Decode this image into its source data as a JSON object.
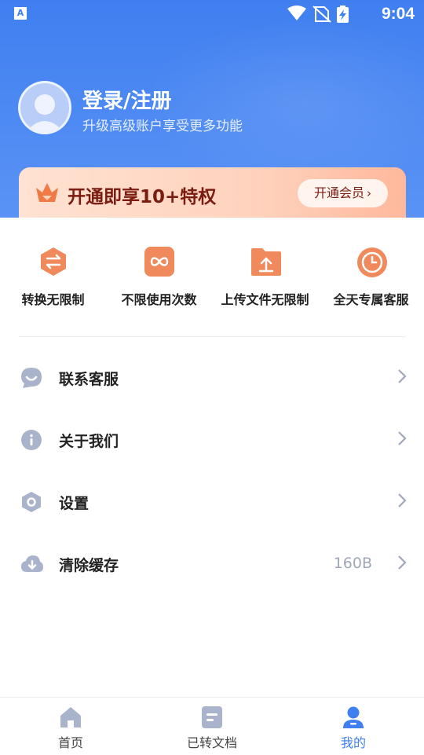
{
  "status_bar": {
    "time": "9:04",
    "left_icon_text": "A",
    "icons": [
      "wifi-icon",
      "sim-off-icon",
      "battery-charging-icon"
    ]
  },
  "profile": {
    "title": "登录/注册",
    "subtitle": "升级高级账户享受更多功能"
  },
  "vip_banner": {
    "label": "开通即享10+特权",
    "button_label": "开通会员",
    "chevron": "›"
  },
  "features": [
    {
      "label": "转换无限制",
      "icon": "swap-icon"
    },
    {
      "label": "不限使用次数",
      "icon": "infinity-icon"
    },
    {
      "label": "上传文件无限制",
      "icon": "upload-folder-icon"
    },
    {
      "label": "全天专属客服",
      "icon": "clock-icon"
    }
  ],
  "menu": [
    {
      "label": "联系客服",
      "icon": "chat-icon",
      "value": ""
    },
    {
      "label": "关于我们",
      "icon": "info-icon",
      "value": ""
    },
    {
      "label": "设置",
      "icon": "settings-icon",
      "value": ""
    },
    {
      "label": "清除缓存",
      "icon": "cloud-download-icon",
      "value": "160B"
    }
  ],
  "tabbar": [
    {
      "label": "首页",
      "icon": "home-icon",
      "active": false
    },
    {
      "label": "已转文档",
      "icon": "document-icon",
      "active": false
    },
    {
      "label": "我的",
      "icon": "user-icon",
      "active": true
    }
  ],
  "colors": {
    "primary": "#3f7ff0",
    "vip_text": "#7a1c10",
    "feature_icon": "#f08a5c",
    "menu_icon": "#a9b4cc"
  }
}
